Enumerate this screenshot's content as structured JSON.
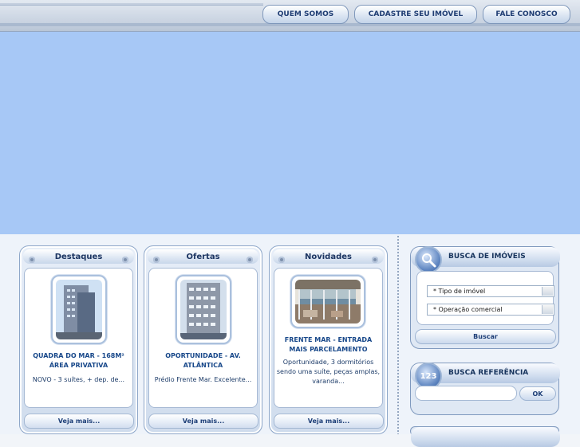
{
  "nav": {
    "items": [
      "QUEM SOMOS",
      "CADASTRE SEU IMÓVEL",
      "FALE CONOSCO"
    ]
  },
  "cards": [
    {
      "title": "Destaques",
      "item_title": "QUADRA DO MAR - 168M² ÁREA PRIVATIVA",
      "description": "NOVO - 3 suítes, + dep. de...",
      "more": "Veja mais..."
    },
    {
      "title": "Ofertas",
      "item_title": "OPORTUNIDADE - AV. ATLÂNTICA",
      "description": "Prédio Frente Mar. Excelente...",
      "more": "Veja mais..."
    },
    {
      "title": "Novidades",
      "item_title": "FRENTE MAR - ENTRADA MAIS PARCELAMENTO",
      "description": "Oportunidade, 3 dormitórios sendo uma suíte, peças amplas, varanda...",
      "more": "Veja mais..."
    }
  ],
  "search": {
    "title": "BUSCA DE IMÓVEIS",
    "property_type": "* Tipo de imóvel",
    "operation": "* Operação comercial",
    "button": "Buscar",
    "icon": "magnifier-icon"
  },
  "reference": {
    "title": "BUSCA REFERÊNCIA",
    "icon_text": "123",
    "button": "OK"
  },
  "colors": {
    "banner": "#a7c8f6",
    "accent": "#1c3562"
  }
}
